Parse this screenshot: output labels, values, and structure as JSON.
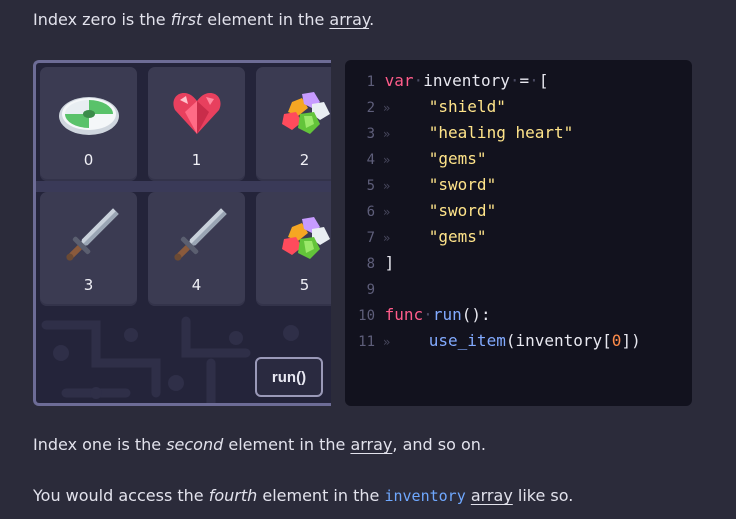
{
  "paragraphs": {
    "p1": {
      "before": "Index zero is the ",
      "em": "first",
      "middle": " element in the ",
      "link": "array",
      "after": "."
    },
    "p2": {
      "before": "Index one is the ",
      "em": "second",
      "middle": " element in the ",
      "link": "array",
      "after": ", and so on."
    },
    "p3": {
      "before": "You would access the ",
      "em": "fourth",
      "middle": " element in the ",
      "code": "inventory",
      "space": " ",
      "link": "array",
      "after": " like so."
    }
  },
  "inventory_slots": [
    {
      "index": "0",
      "item": "shield-icon"
    },
    {
      "index": "1",
      "item": "healing-heart-icon"
    },
    {
      "index": "2",
      "item": "gems-icon"
    },
    {
      "index": "3",
      "item": "sword-icon"
    },
    {
      "index": "4",
      "item": "sword-icon"
    },
    {
      "index": "5",
      "item": "gems-icon"
    }
  ],
  "run_button": {
    "label": "run()"
  },
  "code": {
    "line_numbers": [
      "1",
      "2",
      "3",
      "4",
      "5",
      "6",
      "7",
      "8",
      "9",
      "10",
      "11"
    ],
    "tab_glyph": "»",
    "kw_var": "var",
    "var_name": "inventory",
    "equals": "=",
    "open_bracket": "[",
    "close_bracket": "]",
    "items": [
      "\"shield\"",
      "\"healing heart\"",
      "\"gems\"",
      "\"sword\"",
      "\"sword\"",
      "\"gems\""
    ],
    "kw_func": "func",
    "func_name": "run",
    "func_rest": "():",
    "call_name": "use_item",
    "call_open": "(inventory[",
    "call_index": "0",
    "call_close": "])"
  },
  "colors": {
    "background": "#2b2b3a",
    "panel_border": "#6d6c96",
    "code_bg": "#12121e",
    "keyword": "#ff5c8a",
    "string": "#ffe48a",
    "function": "#82aaff",
    "number": "#ff8c4a"
  }
}
